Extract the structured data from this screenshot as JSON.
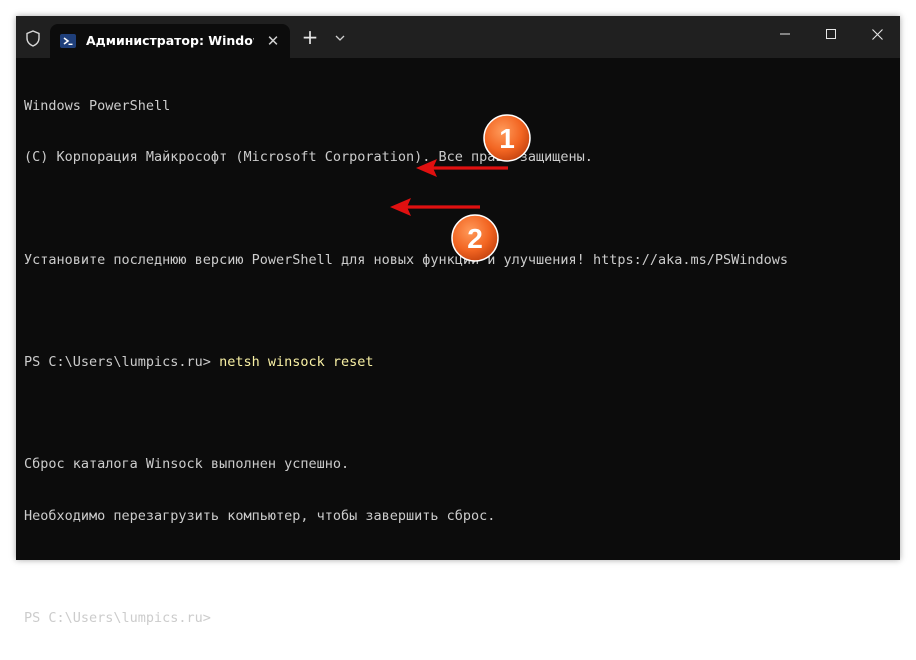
{
  "tab": {
    "title": "Администратор: Windows PowerShell",
    "close_glyph": "✕"
  },
  "titlebar": {
    "new_tab_glyph": "+"
  },
  "terminal": {
    "line1": "Windows PowerShell",
    "line2": "(C) Корпорация Майкрософт (Microsoft Corporation). Все права защищены.",
    "line3": "Установите последнюю версию PowerShell для новых функций и улучшения! https://aka.ms/PSWindows",
    "prompt1": "PS C:\\Users\\lumpics.ru> ",
    "command": "netsh winsock reset",
    "line5": "Сброс каталога Winsock выполнен успешно.",
    "line6": "Необходимо перезагрузить компьютер, чтобы завершить сброс.",
    "prompt2": "PS C:\\Users\\lumpics.ru>"
  },
  "annotations": {
    "marker1": "1",
    "marker2": "2"
  },
  "colors": {
    "background": "#0c0c0c",
    "titlebar": "#202020",
    "text": "#cccccc",
    "command": "#f9f1a5",
    "marker_orange": "#f26522",
    "arrow_red": "#e01010"
  },
  "icons": {
    "shield": "shield-icon",
    "tab": "powershell-icon",
    "close_tab": "close-icon",
    "new_tab": "plus-icon",
    "dropdown": "chevron-down-icon",
    "minimize": "minimize-icon",
    "maximize": "maximize-icon",
    "close_window": "close-icon"
  }
}
